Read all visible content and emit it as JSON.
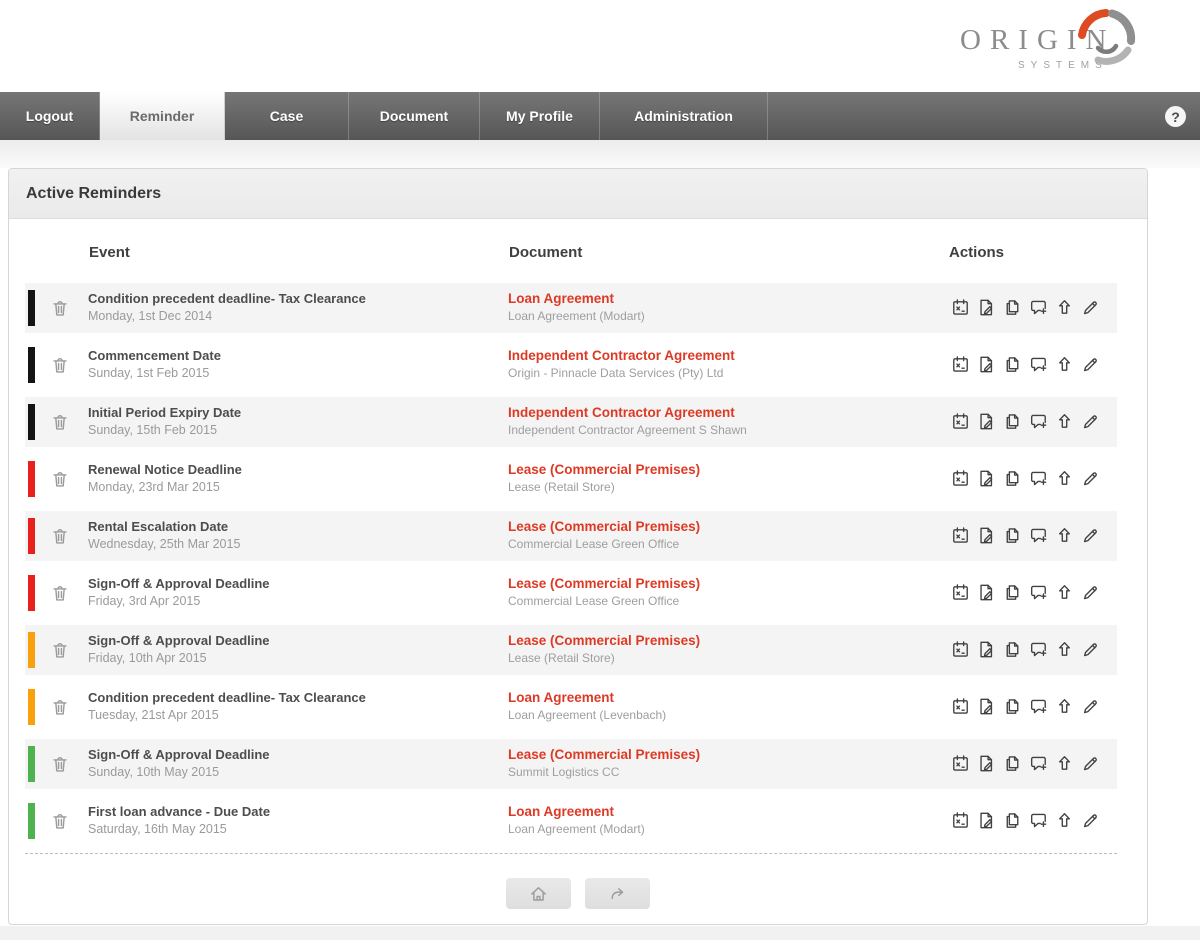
{
  "brand": {
    "name": "ORIGIN",
    "tagline": "SYSTEMS"
  },
  "nav": {
    "tabs": [
      {
        "label": "Logout",
        "active": false
      },
      {
        "label": "Reminder",
        "active": true
      },
      {
        "label": "Case",
        "active": false
      },
      {
        "label": "Document",
        "active": false
      },
      {
        "label": "My Profile",
        "active": false
      },
      {
        "label": "Administration",
        "active": false
      }
    ],
    "help_label": "?"
  },
  "page": {
    "title": "Active Reminders"
  },
  "table": {
    "headers": {
      "event": "Event",
      "document": "Document",
      "actions": "Actions"
    },
    "status_colors": {
      "black": "#141414",
      "red": "#e9211c",
      "orange": "#f7a20c",
      "green": "#4eb24e"
    },
    "action_icons": [
      "calendar-icon",
      "document-edit-icon",
      "copy-icon",
      "add-comment-icon",
      "upload-icon",
      "pencil-icon"
    ],
    "rows": [
      {
        "status": "black",
        "event_title": "Condition precedent deadline- Tax Clearance",
        "event_date": "Monday, 1st Dec 2014",
        "doc_title": "Loan Agreement",
        "doc_subtitle": "Loan Agreement (Modart)"
      },
      {
        "status": "black",
        "event_title": "Commencement Date",
        "event_date": "Sunday, 1st Feb 2015",
        "doc_title": "Independent Contractor Agreement",
        "doc_subtitle": "Origin - Pinnacle Data Services (Pty) Ltd"
      },
      {
        "status": "black",
        "event_title": "Initial Period Expiry Date",
        "event_date": "Sunday, 15th Feb 2015",
        "doc_title": "Independent Contractor Agreement",
        "doc_subtitle": "Independent Contractor Agreement S Shawn"
      },
      {
        "status": "red",
        "event_title": "Renewal Notice Deadline",
        "event_date": "Monday, 23rd Mar 2015",
        "doc_title": "Lease (Commercial Premises)",
        "doc_subtitle": "Lease (Retail Store)"
      },
      {
        "status": "red",
        "event_title": "Rental Escalation Date",
        "event_date": "Wednesday, 25th Mar 2015",
        "doc_title": "Lease (Commercial Premises)",
        "doc_subtitle": "Commercial Lease Green Office"
      },
      {
        "status": "red",
        "event_title": "Sign-Off & Approval Deadline",
        "event_date": "Friday, 3rd Apr 2015",
        "doc_title": "Lease (Commercial Premises)",
        "doc_subtitle": "Commercial Lease Green Office"
      },
      {
        "status": "orange",
        "event_title": "Sign-Off & Approval Deadline",
        "event_date": "Friday, 10th Apr 2015",
        "doc_title": "Lease (Commercial Premises)",
        "doc_subtitle": "Lease (Retail Store)"
      },
      {
        "status": "orange",
        "event_title": "Condition precedent deadline- Tax Clearance",
        "event_date": "Tuesday, 21st Apr 2015",
        "doc_title": "Loan Agreement",
        "doc_subtitle": "Loan Agreement (Levenbach)"
      },
      {
        "status": "green",
        "event_title": "Sign-Off & Approval Deadline",
        "event_date": "Sunday, 10th May 2015",
        "doc_title": "Lease (Commercial Premises)",
        "doc_subtitle": "Summit Logistics CC"
      },
      {
        "status": "green",
        "event_title": "First loan advance - Due Date",
        "event_date": "Saturday, 16th May 2015",
        "doc_title": "Loan Agreement",
        "doc_subtitle": "Loan Agreement (Modart)"
      }
    ]
  },
  "footer": {
    "buttons": [
      "home-icon",
      "forward-icon"
    ]
  },
  "colors": {
    "accent_red": "#dd3a25",
    "nav_dark": "#5f5f5f",
    "row_stripe": "#f4f4f4",
    "logo_orange": "#de4a22"
  }
}
